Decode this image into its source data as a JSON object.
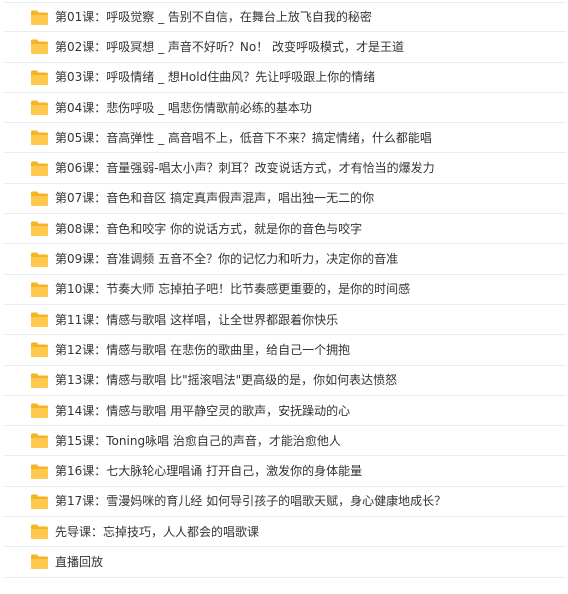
{
  "folders": [
    {
      "name": "第01课：呼吸觉察 _ 告别不自信，在舞台上放飞自我的秘密",
      "icon": "folder-icon"
    },
    {
      "name": "第02课：呼吸冥想 _ 声音不好听？No！ 改变呼吸模式，才是王道",
      "icon": "folder-icon"
    },
    {
      "name": "第03课：呼吸情绪 _ 想Hold住曲风？先让呼吸跟上你的情绪",
      "icon": "folder-icon"
    },
    {
      "name": "第04课：悲伤呼吸 _ 唱悲伤情歌前必练的基本功",
      "icon": "folder-icon"
    },
    {
      "name": "第05课：音高弹性 _ 高音唱不上，低音下不来？搞定情绪，什么都能唱",
      "icon": "folder-icon"
    },
    {
      "name": "第06课：音量强弱-唱太小声？刺耳？改变说话方式，才有恰当的爆发力",
      "icon": "folder-icon"
    },
    {
      "name": "第07课：音色和音区 搞定真声假声混声，唱出独一无二的你",
      "icon": "folder-icon"
    },
    {
      "name": "第08课：音色和咬字 你的说话方式，就是你的音色与咬字",
      "icon": "folder-icon"
    },
    {
      "name": "第09课：音准调频 五音不全？你的记忆力和听力，决定你的音准",
      "icon": "folder-icon"
    },
    {
      "name": "第10课：节奏大师 忘掉拍子吧！比节奏感更重要的，是你的时间感",
      "icon": "folder-icon"
    },
    {
      "name": "第11课：情感与歌唱 这样唱，让全世界都跟着你快乐",
      "icon": "folder-icon"
    },
    {
      "name": "第12课：情感与歌唱 在悲伤的歌曲里，给自己一个拥抱",
      "icon": "folder-icon"
    },
    {
      "name": "第13课：情感与歌唱 比\"摇滚唱法\"更高级的是，你如何表达愤怒",
      "icon": "folder-icon"
    },
    {
      "name": "第14课：情感与歌唱 用平静空灵的歌声，安抚躁动的心",
      "icon": "folder-icon"
    },
    {
      "name": "第15课：Toning咏唱 治愈自己的声音，才能治愈他人",
      "icon": "folder-icon"
    },
    {
      "name": "第16课：七大脉轮心理唱诵 打开自己，激发你的身体能量",
      "icon": "folder-icon"
    },
    {
      "name": "第17课：雪漫妈咪的育儿经 如何导引孩子的唱歌天赋，身心健康地成长？",
      "icon": "folder-icon"
    },
    {
      "name": "先导课：忘掉技巧，人人都会的唱歌课",
      "icon": "folder-icon"
    },
    {
      "name": "直播回放",
      "icon": "folder-icon"
    }
  ],
  "colors": {
    "folder_fill": "#FFC94D",
    "folder_back": "#F5B325",
    "text": "#333333",
    "row_divider": "#ECECEC"
  }
}
